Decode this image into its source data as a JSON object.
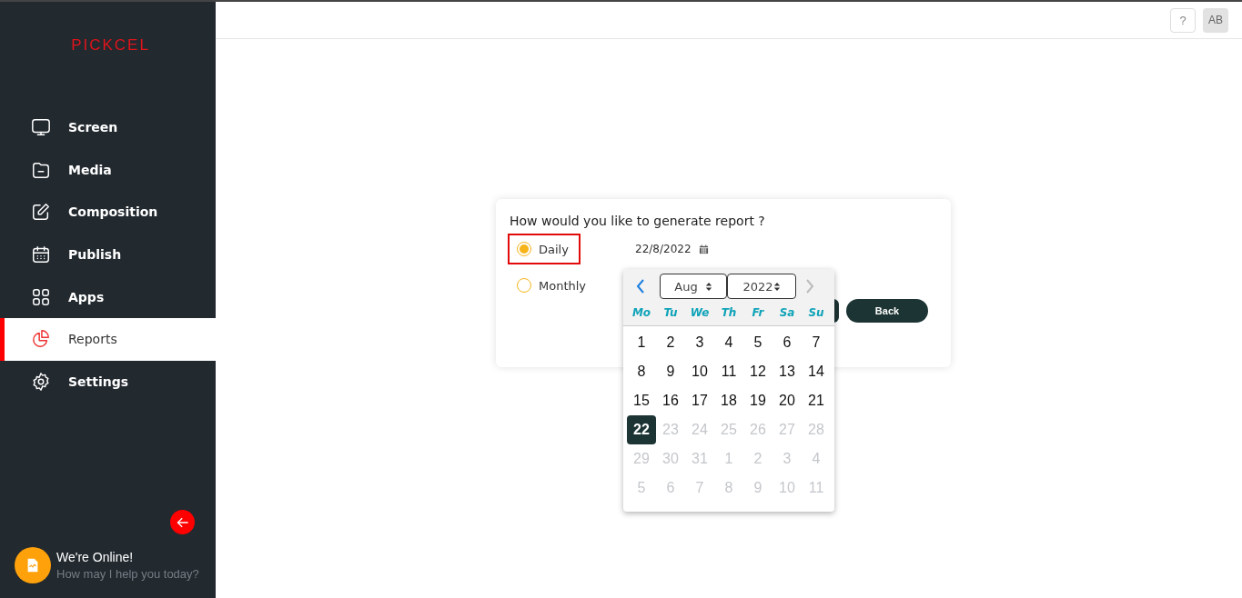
{
  "logo": "PICKCEL",
  "sidebar": {
    "items": [
      {
        "label": "Screen",
        "selected": false
      },
      {
        "label": "Media",
        "selected": false
      },
      {
        "label": "Composition",
        "selected": false
      },
      {
        "label": "Publish",
        "selected": false
      },
      {
        "label": "Apps",
        "selected": false
      },
      {
        "label": "Reports",
        "selected": true
      },
      {
        "label": "Settings",
        "selected": false
      }
    ]
  },
  "chat": {
    "title": "We're Online!",
    "subtitle": "How may I help you today?"
  },
  "topbar": {
    "help": "?",
    "avatar": "AB"
  },
  "dialog": {
    "question": "How would you like to generate report ?",
    "options": [
      {
        "label": "Daily",
        "selected": true,
        "highlighted": true
      },
      {
        "label": "Monthly",
        "selected": false,
        "highlighted": false
      }
    ],
    "date": "22/8/2022",
    "back_button": "Back"
  },
  "calendar": {
    "month": "Aug",
    "year": "2022",
    "prev_enabled": true,
    "next_enabled": false,
    "weekdays": [
      "Mo",
      "Tu",
      "We",
      "Th",
      "Fr",
      "Sa",
      "Su"
    ],
    "weeks": [
      [
        {
          "day": "1",
          "muted": false,
          "selected": false
        },
        {
          "day": "2",
          "muted": false,
          "selected": false
        },
        {
          "day": "3",
          "muted": false,
          "selected": false
        },
        {
          "day": "4",
          "muted": false,
          "selected": false
        },
        {
          "day": "5",
          "muted": false,
          "selected": false
        },
        {
          "day": "6",
          "muted": false,
          "selected": false
        },
        {
          "day": "7",
          "muted": false,
          "selected": false
        }
      ],
      [
        {
          "day": "8",
          "muted": false,
          "selected": false
        },
        {
          "day": "9",
          "muted": false,
          "selected": false
        },
        {
          "day": "10",
          "muted": false,
          "selected": false
        },
        {
          "day": "11",
          "muted": false,
          "selected": false
        },
        {
          "day": "12",
          "muted": false,
          "selected": false
        },
        {
          "day": "13",
          "muted": false,
          "selected": false
        },
        {
          "day": "14",
          "muted": false,
          "selected": false
        }
      ],
      [
        {
          "day": "15",
          "muted": false,
          "selected": false
        },
        {
          "day": "16",
          "muted": false,
          "selected": false
        },
        {
          "day": "17",
          "muted": false,
          "selected": false
        },
        {
          "day": "18",
          "muted": false,
          "selected": false
        },
        {
          "day": "19",
          "muted": false,
          "selected": false
        },
        {
          "day": "20",
          "muted": false,
          "selected": false
        },
        {
          "day": "21",
          "muted": false,
          "selected": false
        }
      ],
      [
        {
          "day": "22",
          "muted": false,
          "selected": true
        },
        {
          "day": "23",
          "muted": true,
          "selected": false
        },
        {
          "day": "24",
          "muted": true,
          "selected": false
        },
        {
          "day": "25",
          "muted": true,
          "selected": false
        },
        {
          "day": "26",
          "muted": true,
          "selected": false
        },
        {
          "day": "27",
          "muted": true,
          "selected": false
        },
        {
          "day": "28",
          "muted": true,
          "selected": false
        }
      ],
      [
        {
          "day": "29",
          "muted": true,
          "selected": false
        },
        {
          "day": "30",
          "muted": true,
          "selected": false
        },
        {
          "day": "31",
          "muted": true,
          "selected": false
        },
        {
          "day": "1",
          "muted": true,
          "selected": false
        },
        {
          "day": "2",
          "muted": true,
          "selected": false
        },
        {
          "day": "3",
          "muted": true,
          "selected": false
        },
        {
          "day": "4",
          "muted": true,
          "selected": false
        }
      ],
      [
        {
          "day": "5",
          "muted": true,
          "selected": false
        },
        {
          "day": "6",
          "muted": true,
          "selected": false
        },
        {
          "day": "7",
          "muted": true,
          "selected": false
        },
        {
          "day": "8",
          "muted": true,
          "selected": false
        },
        {
          "day": "9",
          "muted": true,
          "selected": false
        },
        {
          "day": "10",
          "muted": true,
          "selected": false
        },
        {
          "day": "11",
          "muted": true,
          "selected": false
        }
      ]
    ]
  }
}
